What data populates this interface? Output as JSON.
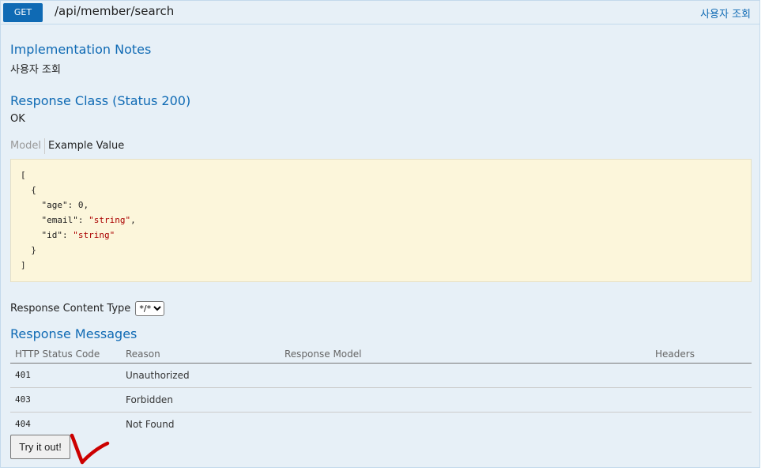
{
  "operation": {
    "method": "GET",
    "path": "/api/member/search",
    "summary": "사용자 조회"
  },
  "implementation": {
    "heading": "Implementation Notes",
    "text": "사용자 조회"
  },
  "response_class": {
    "heading": "Response Class (Status 200)",
    "text": "OK"
  },
  "model_tabs": {
    "model": "Model",
    "example": "Example Value"
  },
  "example_value": {
    "open": "[",
    "obj_open": "{",
    "fields": [
      {
        "key": "\"age\"",
        "sep": ": ",
        "value": "0",
        "suffix": ","
      },
      {
        "key": "\"email\"",
        "sep": ": ",
        "value": "\"string\"",
        "suffix": ","
      },
      {
        "key": "\"id\"",
        "sep": ": ",
        "value": "\"string\"",
        "suffix": ""
      }
    ],
    "obj_close": "}",
    "close": "]"
  },
  "response_content_type": {
    "label": "Response Content Type",
    "selected": "*/*"
  },
  "response_messages": {
    "heading": "Response Messages",
    "columns": [
      "HTTP Status Code",
      "Reason",
      "Response Model",
      "Headers"
    ],
    "rows": [
      {
        "code": "401",
        "reason": "Unauthorized",
        "model": "",
        "headers": ""
      },
      {
        "code": "403",
        "reason": "Forbidden",
        "model": "",
        "headers": ""
      },
      {
        "code": "404",
        "reason": "Not Found",
        "model": "",
        "headers": ""
      }
    ]
  },
  "try_button": "Try it out!",
  "colors": {
    "accent": "#0f6ab4",
    "panel_bg": "#e7f0f7",
    "example_bg": "#fcf6db",
    "annotation": "#cc0000"
  }
}
